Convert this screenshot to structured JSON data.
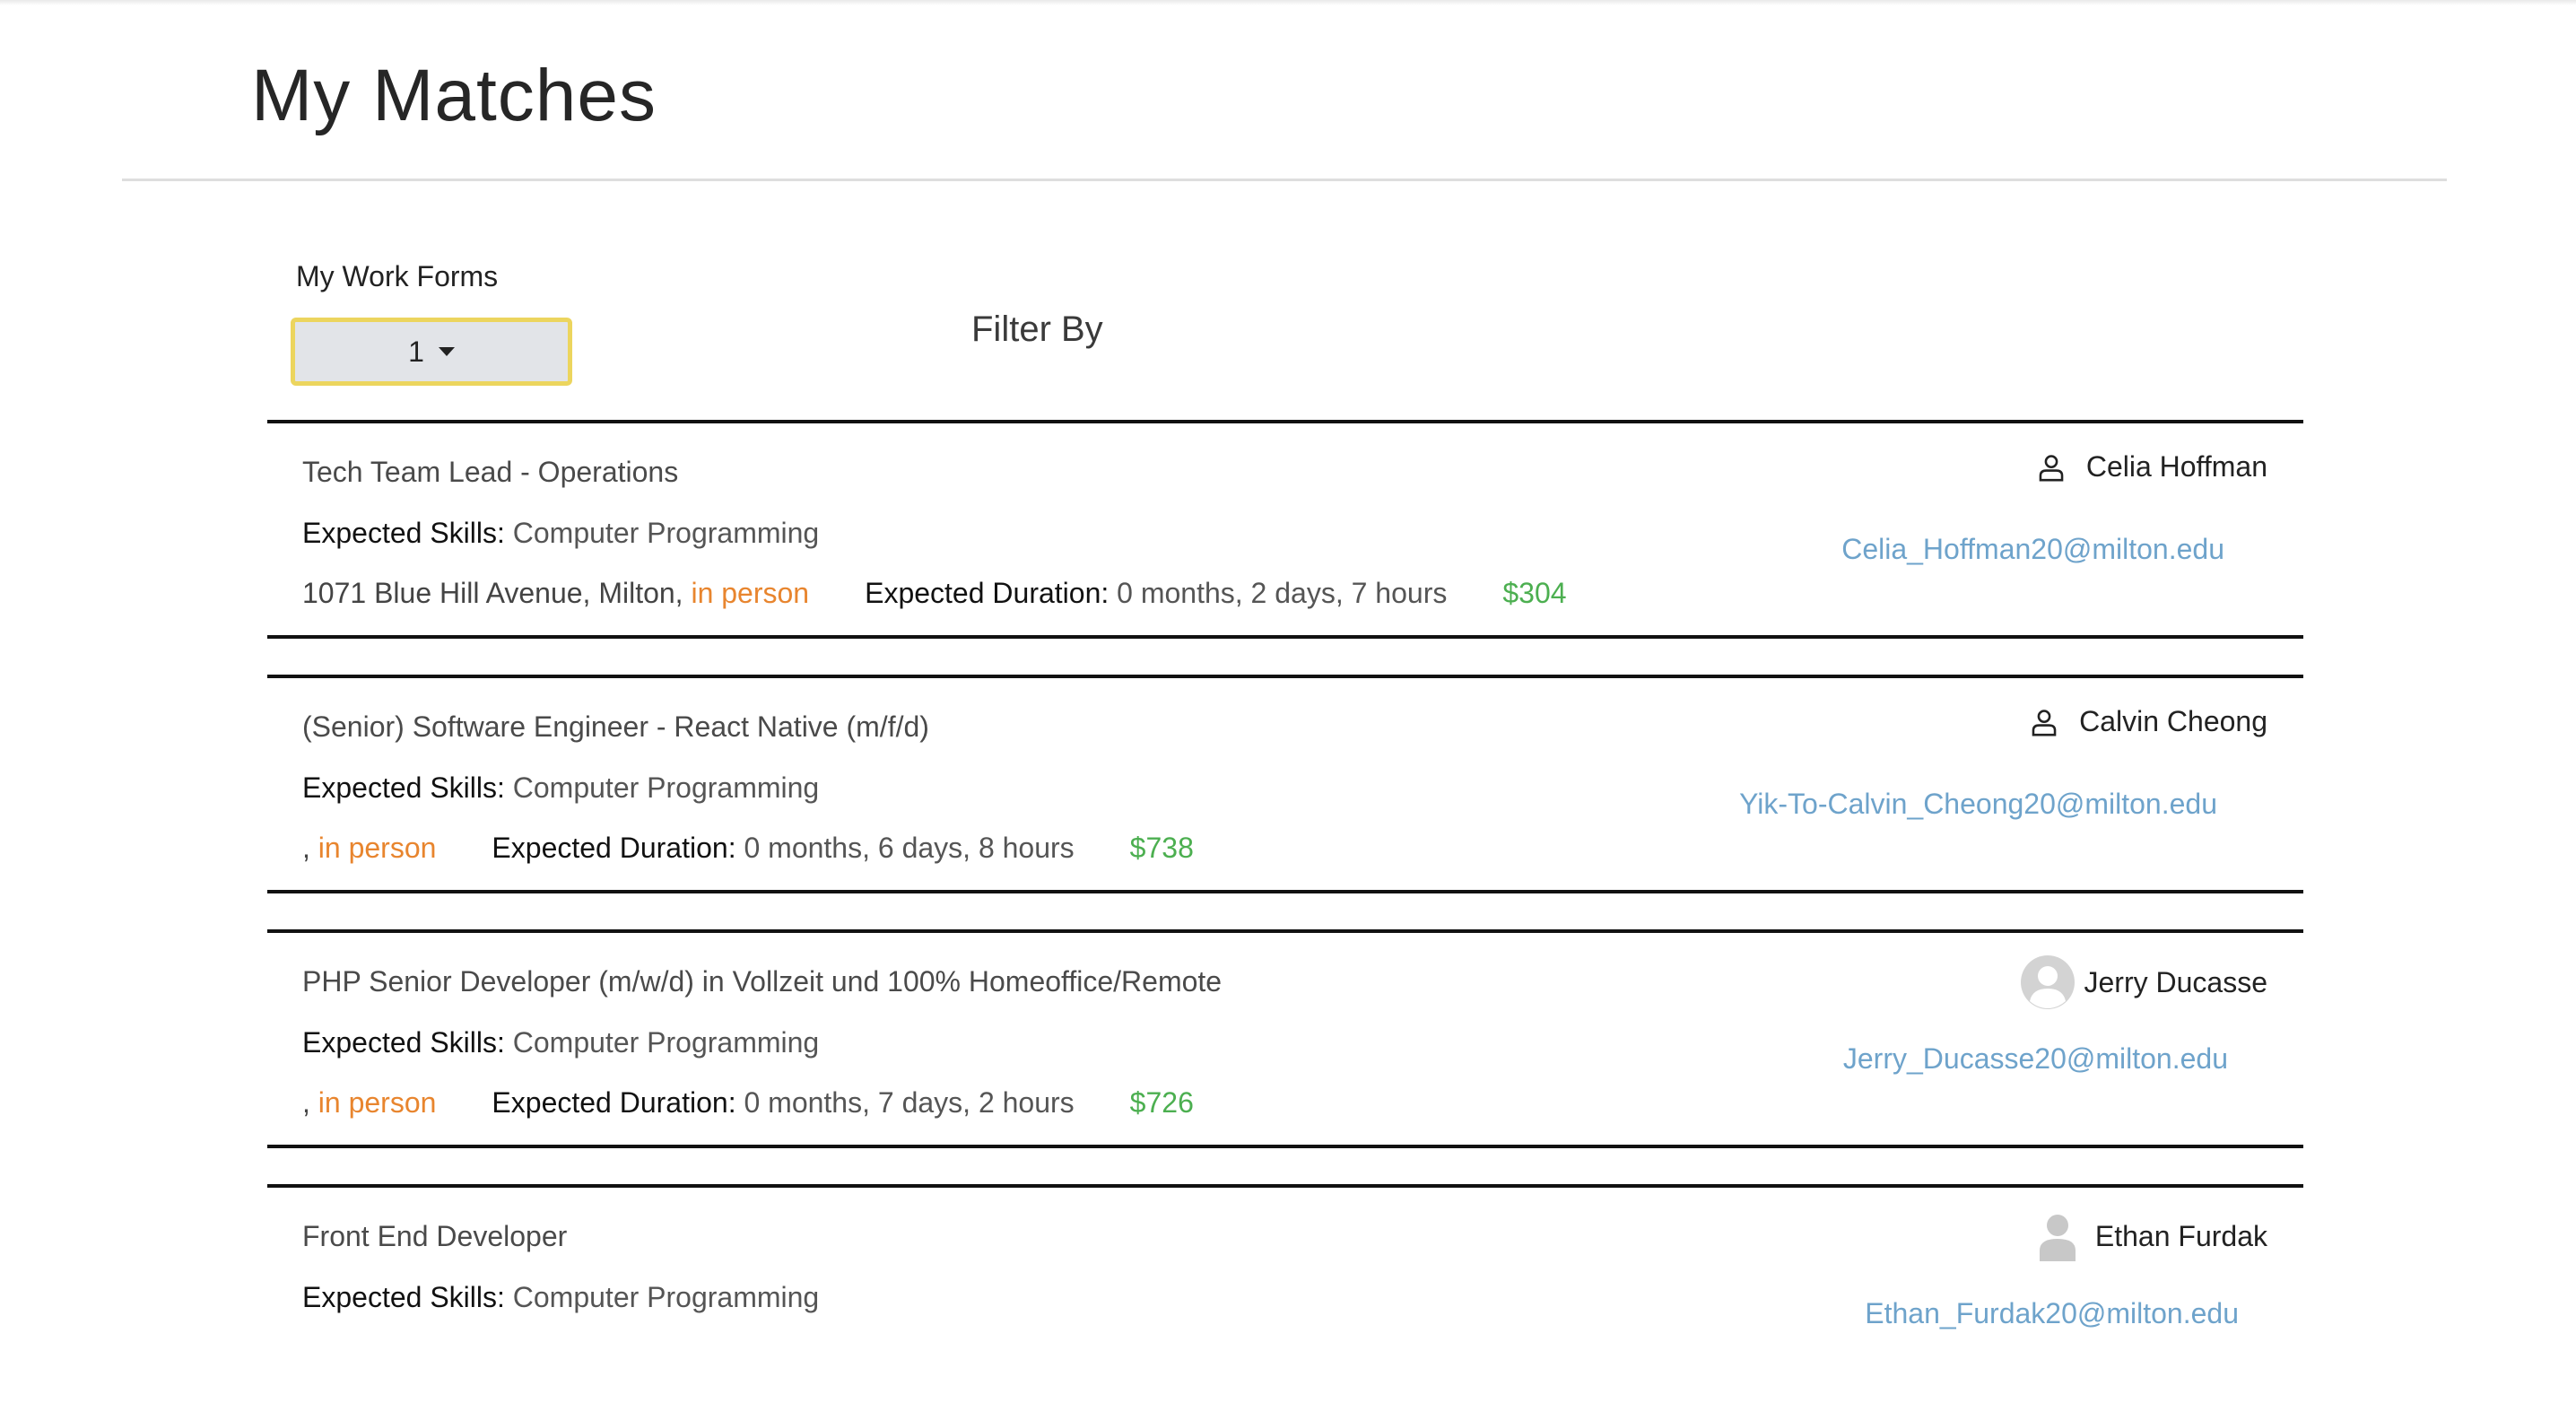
{
  "page": {
    "title": "My Matches"
  },
  "work_forms": {
    "label": "My Work Forms",
    "selected": "1"
  },
  "filter": {
    "label": "Filter By"
  },
  "labels": {
    "skills": "Expected Skills:",
    "duration": "Expected Duration:"
  },
  "colors": {
    "accent_border": "#ecd55e",
    "link": "#6ea3cb",
    "mode": "#e8852e",
    "pay": "#4caf50"
  },
  "matches": [
    {
      "job_title": "Tech Team Lead - Operations",
      "skills": "Computer Programming",
      "address": "1071 Blue Hill Avenue, Milton, ",
      "mode": "in person",
      "duration": "0 months, 2 days, 7 hours",
      "pay": "$304",
      "person_name": "Celia Hoffman",
      "person_icon": "user-outline-icon",
      "email": "Celia_Hoffman20@milton.edu"
    },
    {
      "job_title": "(Senior) Software Engineer - React Native (m/f/d)",
      "skills": "Computer Programming",
      "address": ", ",
      "mode": "in person",
      "duration": "0 months, 6 days, 8 hours",
      "pay": "$738",
      "person_name": "Calvin Cheong",
      "person_icon": "user-outline-icon",
      "email": "Yik-To-Calvin_Cheong20@milton.edu"
    },
    {
      "job_title": "PHP Senior Developer (m/w/d) in Vollzeit und 100% Homeoffice/Remote",
      "skills": "Computer Programming",
      "address": ", ",
      "mode": "in person",
      "duration": "0 months, 7 days, 2 hours",
      "pay": "$726",
      "person_name": "Jerry Ducasse",
      "person_icon": "avatar-placeholder-icon",
      "email": "Jerry_Ducasse20@milton.edu"
    },
    {
      "job_title": "Front End Developer",
      "skills": "Computer Programming",
      "person_name": "Ethan Furdak",
      "person_icon": "avatar-silhouette-icon",
      "email": "Ethan_Furdak20@milton.edu"
    }
  ]
}
